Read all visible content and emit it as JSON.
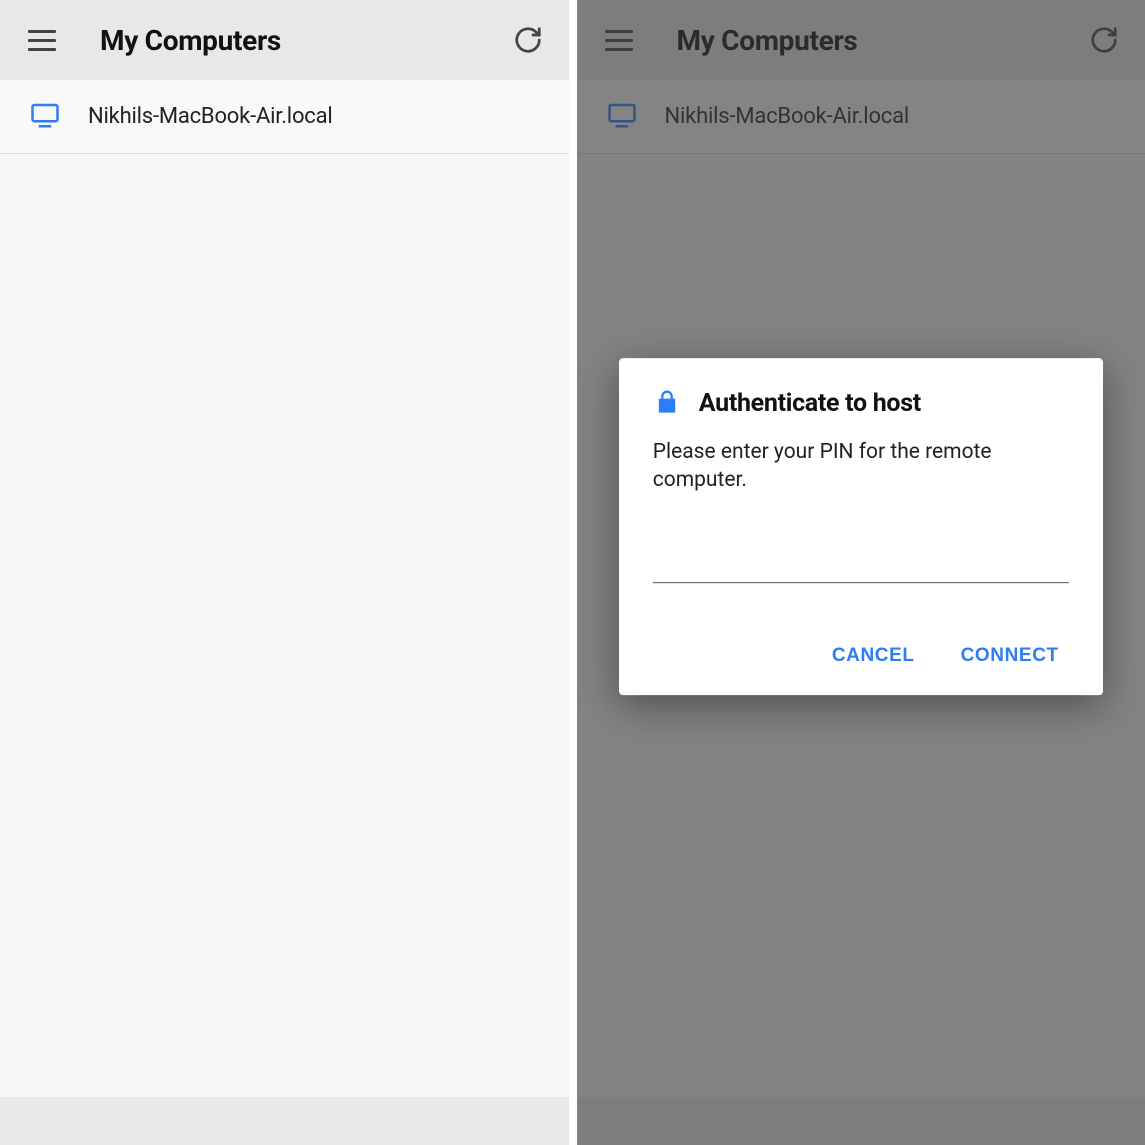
{
  "left": {
    "header": {
      "title": "My Computers"
    },
    "list": [
      {
        "hostname": "Nikhils-MacBook-Air.local"
      }
    ]
  },
  "right": {
    "header": {
      "title": "My Computers"
    },
    "list": [
      {
        "hostname": "Nikhils-MacBook-Air.local"
      }
    ],
    "dialog": {
      "title": "Authenticate to host",
      "message": "Please enter your PIN for the remote computer.",
      "pin_value": "",
      "cancel_label": "CANCEL",
      "connect_label": "CONNECT"
    }
  },
  "colors": {
    "accent": "#2e7cf6",
    "header_bg": "#e8e8e8",
    "body_bg": "#f6f6f6"
  }
}
